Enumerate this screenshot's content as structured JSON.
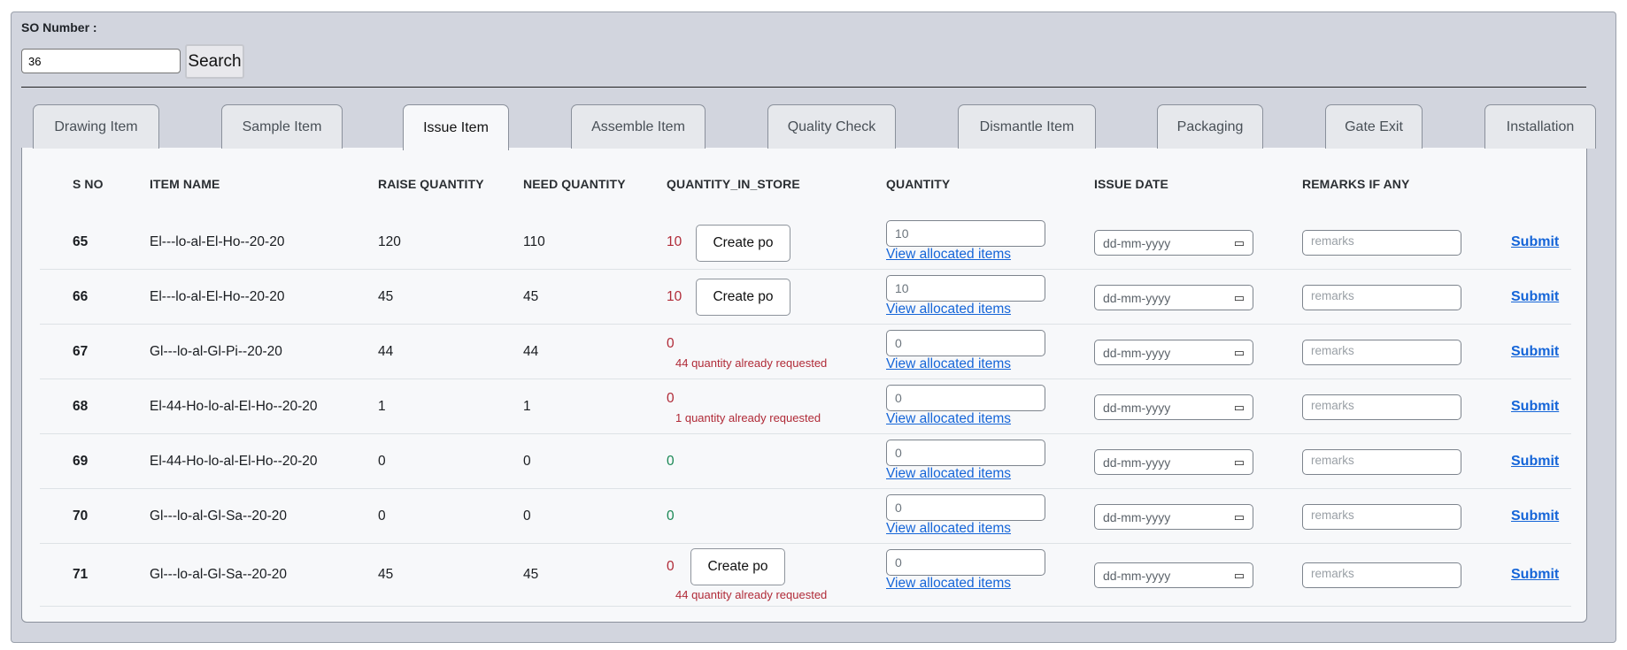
{
  "search": {
    "label": "SO Number :",
    "value": "36",
    "button": "Search"
  },
  "tabs": [
    "Drawing Item",
    "Sample Item",
    "Issue Item",
    "Assemble Item",
    "Quality Check",
    "Dismantle Item",
    "Packaging",
    "Gate Exit",
    "Installation"
  ],
  "active_tab": "Issue Item",
  "table": {
    "headers": [
      "S NO",
      "ITEM NAME",
      "RAISE QUANTITY",
      "NEED QUANTITY",
      "QUANTITY_IN_STORE",
      "QUANTITY",
      "ISSUE DATE",
      "REMARKS IF ANY"
    ],
    "rows": [
      {
        "sno": "65",
        "name": "El---lo-al-El-Ho--20-20",
        "raise": "120",
        "need": "110",
        "store": "10",
        "store_status": "red",
        "create_po": "Create po",
        "requested_note": "",
        "quantity": "10",
        "view_link": "View allocated items",
        "date_placeholder": "dd-mm-yyyy",
        "remarks_placeholder": "remarks",
        "submit": "Submit"
      },
      {
        "sno": "66",
        "name": "El---lo-al-El-Ho--20-20",
        "raise": "45",
        "need": "45",
        "store": "10",
        "store_status": "red",
        "create_po": "Create po",
        "requested_note": "",
        "quantity": "10",
        "view_link": "View allocated items",
        "date_placeholder": "dd-mm-yyyy",
        "remarks_placeholder": "remarks",
        "submit": "Submit"
      },
      {
        "sno": "67",
        "name": "Gl---lo-al-Gl-Pi--20-20",
        "raise": "44",
        "need": "44",
        "store": "0",
        "store_status": "red",
        "create_po": "",
        "requested_note": "44 quantity already requested",
        "quantity": "0",
        "view_link": "View allocated items",
        "date_placeholder": "dd-mm-yyyy",
        "remarks_placeholder": "remarks",
        "submit": "Submit"
      },
      {
        "sno": "68",
        "name": "El-44-Ho-lo-al-El-Ho--20-20",
        "raise": "1",
        "need": "1",
        "store": "0",
        "store_status": "red",
        "create_po": "",
        "requested_note": "1 quantity already requested",
        "quantity": "0",
        "view_link": "View allocated items",
        "date_placeholder": "dd-mm-yyyy",
        "remarks_placeholder": "remarks",
        "submit": "Submit"
      },
      {
        "sno": "69",
        "name": "El-44-Ho-lo-al-El-Ho--20-20",
        "raise": "0",
        "need": "0",
        "store": "0",
        "store_status": "green",
        "create_po": "",
        "requested_note": "",
        "quantity": "0",
        "view_link": "View allocated items",
        "date_placeholder": "dd-mm-yyyy",
        "remarks_placeholder": "remarks",
        "submit": "Submit"
      },
      {
        "sno": "70",
        "name": "Gl---lo-al-Gl-Sa--20-20",
        "raise": "0",
        "need": "0",
        "store": "0",
        "store_status": "green",
        "create_po": "",
        "requested_note": "",
        "quantity": "0",
        "view_link": "View allocated items",
        "date_placeholder": "dd-mm-yyyy",
        "remarks_placeholder": "remarks",
        "submit": "Submit"
      },
      {
        "sno": "71",
        "name": "Gl---lo-al-Gl-Sa--20-20",
        "raise": "45",
        "need": "45",
        "store": "0",
        "store_status": "red",
        "create_po": "Create po",
        "requested_note": "44 quantity already requested",
        "quantity": "0",
        "view_link": "View allocated items",
        "date_placeholder": "dd-mm-yyyy",
        "remarks_placeholder": "remarks",
        "submit": "Submit"
      }
    ]
  },
  "icons": {
    "date_picker": "calendar-icon"
  },
  "colors": {
    "link": "#1565d8",
    "danger": "#b02a37",
    "success": "#198754",
    "frame": "#d2d5de"
  }
}
